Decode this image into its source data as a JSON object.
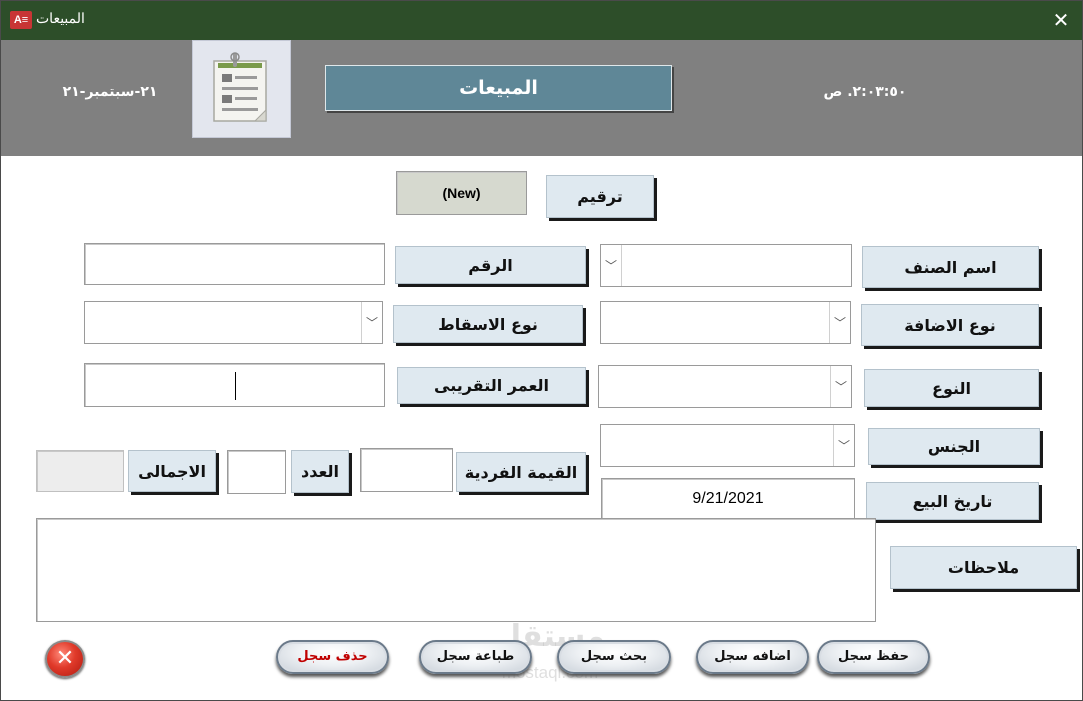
{
  "window": {
    "title": "المبيعات",
    "app_icon_text": "A≡",
    "close_glyph": "✕"
  },
  "header": {
    "date": "٢١-سبتمبر-٢١",
    "title": "المبيعات",
    "time": "٢:٠٣:٥٠. ص"
  },
  "form": {
    "serial": {
      "label": "ترقيم",
      "value": "(New)"
    },
    "item_name": {
      "label": "اسم الصنف",
      "value": ""
    },
    "number": {
      "label": "الرقم",
      "value": ""
    },
    "addition_type": {
      "label": "نوع الاضافة",
      "value": ""
    },
    "drop_type": {
      "label": "نوع الاسقاط",
      "value": ""
    },
    "kind": {
      "label": "النوع",
      "value": ""
    },
    "approx_age": {
      "label": "العمر التقريبى",
      "value": ""
    },
    "gender": {
      "label": "الجنس",
      "value": ""
    },
    "unit_value": {
      "label": "القيمة الفردية",
      "value": ""
    },
    "count": {
      "label": "العدد",
      "value": ""
    },
    "total": {
      "label": "الاجمالى",
      "value": ""
    },
    "sale_date": {
      "label": "تاريخ البيع",
      "value": "9/21/2021"
    },
    "notes": {
      "label": "ملاحظات",
      "value": ""
    }
  },
  "buttons": {
    "save": "حفظ سجل",
    "add": "اضافه سجل",
    "search": "بحث سجل",
    "print": "طباعة سجل",
    "delete": "حذف سجل",
    "exit_glyph": "✕"
  },
  "combo_arrow": "﹀",
  "watermark": {
    "text": "مستقل",
    "sub": "mostaql.com"
  },
  "colors": {
    "titlebar": "#2d4e29",
    "header": "#808080",
    "title_box": "#5f8797",
    "label_bg": "#dfe9f0",
    "delete_text": "#c00000"
  }
}
